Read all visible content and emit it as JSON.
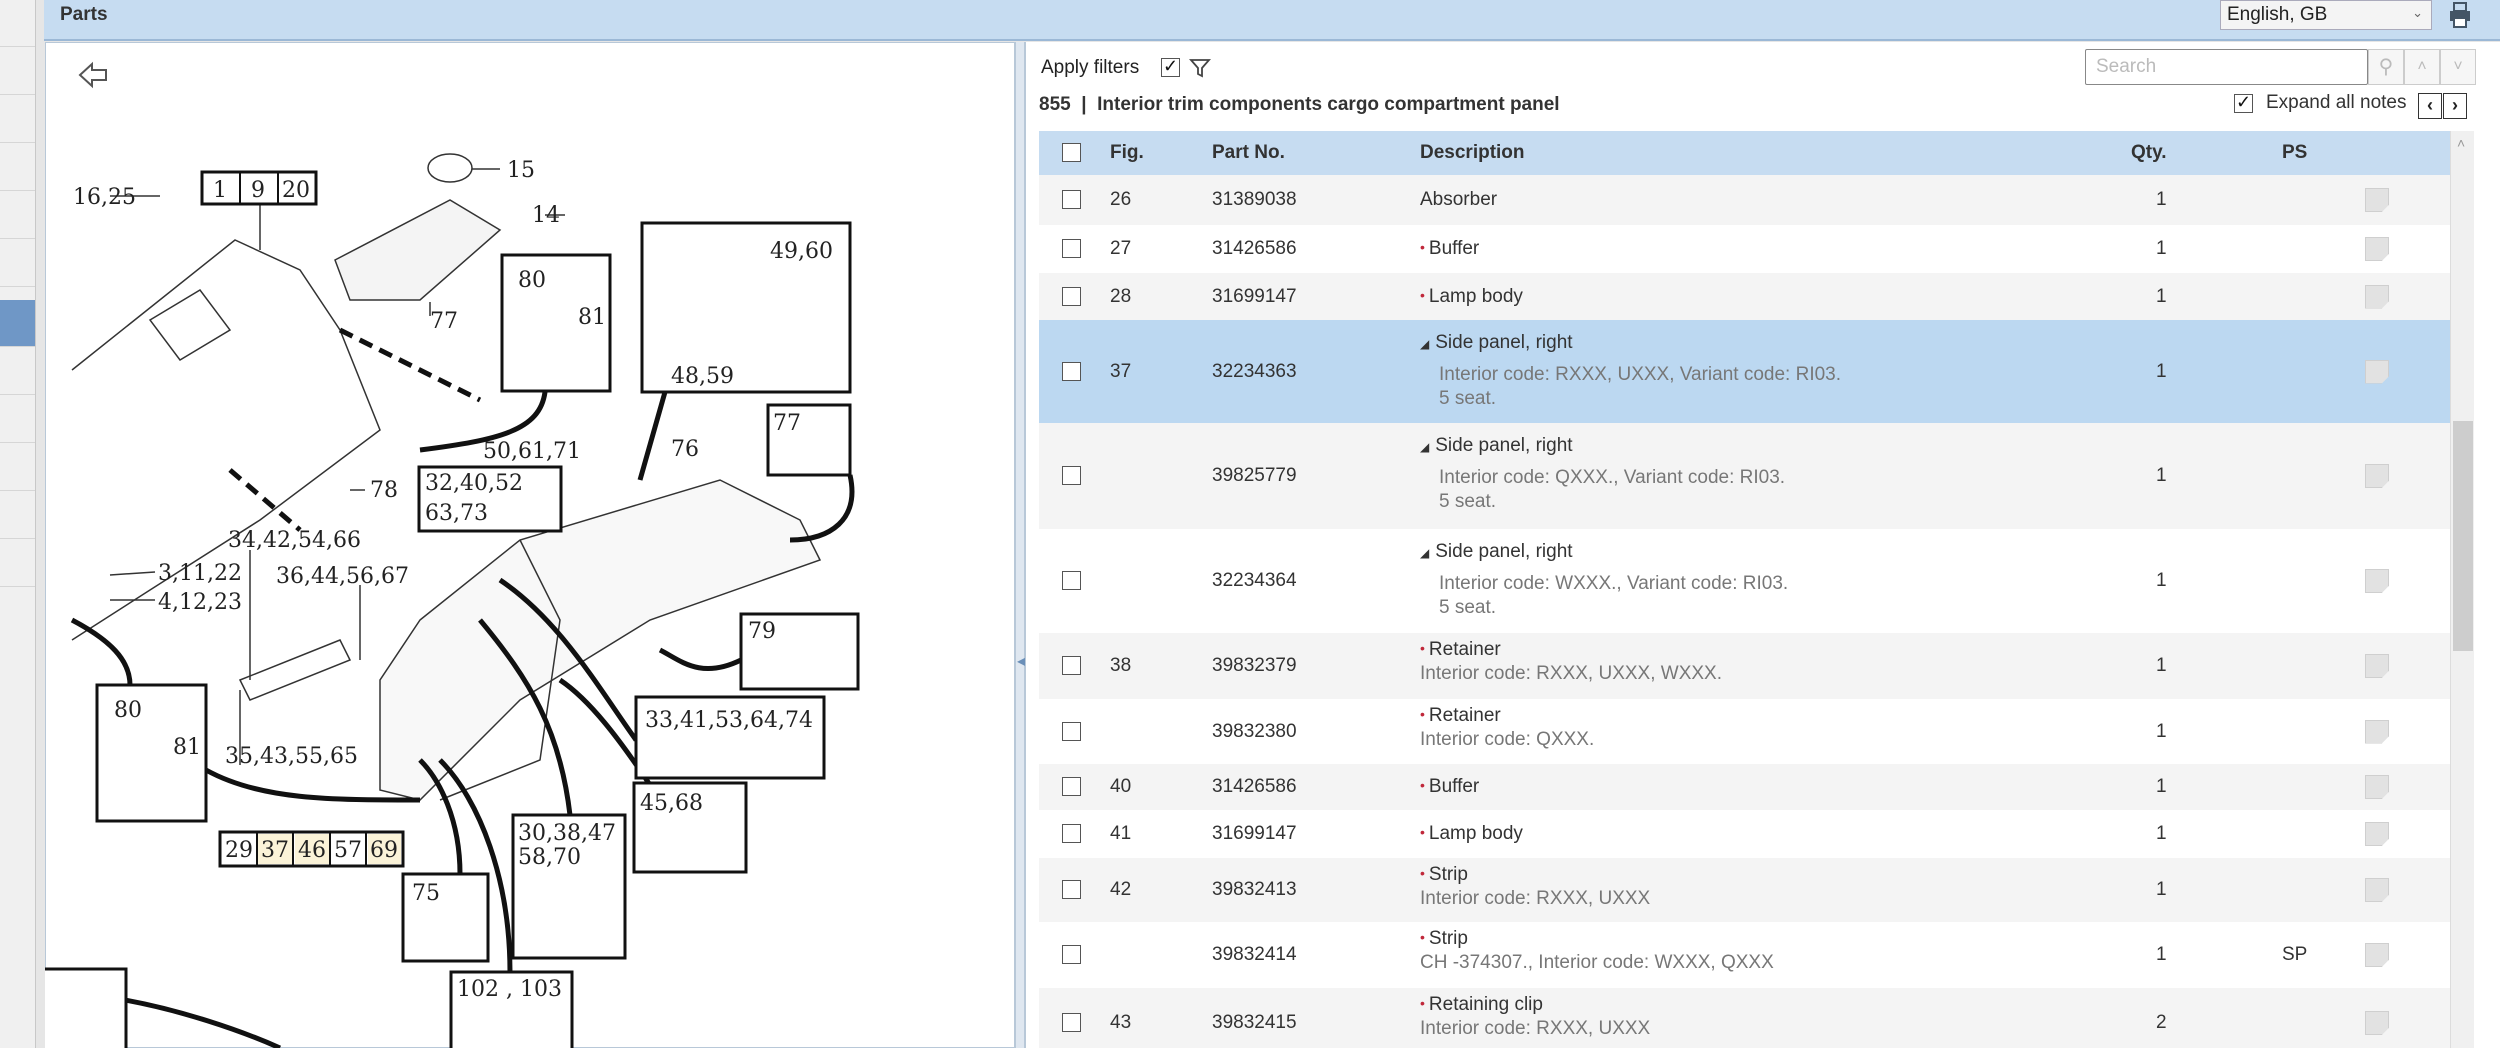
{
  "header": {
    "title": "Parts",
    "language": "English, GB"
  },
  "filters": {
    "apply_label": "Apply filters",
    "apply_checked": true,
    "search_placeholder": "Search",
    "expand_label": "Expand all notes",
    "expand_checked": true
  },
  "section": {
    "code": "855",
    "separator": "|",
    "title": "Interior trim components cargo compartment panel"
  },
  "table": {
    "columns": {
      "fig": "Fig.",
      "part": "Part No.",
      "desc": "Description",
      "qty": "Qty.",
      "ps": "PS"
    },
    "rows": [
      {
        "fig": "26",
        "part": "31389038",
        "desc": "Absorber",
        "marker": "none",
        "notes": [],
        "qty": "1",
        "ps": ""
      },
      {
        "fig": "27",
        "part": "31426586",
        "desc": "Buffer",
        "marker": "dot",
        "notes": [],
        "qty": "1",
        "ps": ""
      },
      {
        "fig": "28",
        "part": "31699147",
        "desc": "Lamp body",
        "marker": "dot",
        "notes": [],
        "qty": "1",
        "ps": ""
      },
      {
        "fig": "37",
        "part": "32234363",
        "desc": "Side panel, right",
        "marker": "triangle",
        "notes": [
          "Interior code: RXXX, UXXX, Variant code: RI03.",
          "5 seat."
        ],
        "qty": "1",
        "ps": "",
        "selected": true
      },
      {
        "fig": "",
        "part": "39825779",
        "desc": "Side panel, right",
        "marker": "triangle",
        "notes": [
          "Interior code: QXXX., Variant code: RI03.",
          "5 seat."
        ],
        "qty": "1",
        "ps": ""
      },
      {
        "fig": "",
        "part": "32234364",
        "desc": "Side panel, right",
        "marker": "triangle",
        "notes": [
          "Interior code: WXXX., Variant code: RI03.",
          "5 seat."
        ],
        "qty": "1",
        "ps": ""
      },
      {
        "fig": "38",
        "part": "39832379",
        "desc": "Retainer",
        "marker": "dot",
        "notes": [
          "Interior code: RXXX, UXXX, WXXX."
        ],
        "qty": "1",
        "ps": ""
      },
      {
        "fig": "",
        "part": "39832380",
        "desc": "Retainer",
        "marker": "dot",
        "notes": [
          "Interior code: QXXX."
        ],
        "qty": "1",
        "ps": ""
      },
      {
        "fig": "40",
        "part": "31426586",
        "desc": "Buffer",
        "marker": "dot",
        "notes": [],
        "qty": "1",
        "ps": ""
      },
      {
        "fig": "41",
        "part": "31699147",
        "desc": "Lamp body",
        "marker": "dot",
        "notes": [],
        "qty": "1",
        "ps": ""
      },
      {
        "fig": "42",
        "part": "39832413",
        "desc": "Strip",
        "marker": "dot",
        "notes": [
          "Interior code: RXXX, UXXX"
        ],
        "qty": "1",
        "ps": ""
      },
      {
        "fig": "",
        "part": "39832414",
        "desc": "Strip",
        "marker": "dot",
        "notes": [
          "CH -374307., Interior code: WXXX, QXXX"
        ],
        "qty": "1",
        "ps": "SP"
      },
      {
        "fig": "43",
        "part": "39832415",
        "desc": "Retaining clip",
        "marker": "dot",
        "notes": [
          "Interior code: RXXX, UXXX"
        ],
        "qty": "2",
        "ps": ""
      }
    ]
  },
  "diagram": {
    "labels": [
      "16,25",
      "1",
      "9",
      "20",
      "15",
      "14",
      "77",
      "80",
      "81",
      "49,60",
      "48,59",
      "77",
      "50,61,71",
      "76",
      "32,40,52",
      "63,73",
      "78",
      "34,42,54,66",
      "3,11,22",
      "4,12,23",
      "36,44,56,67",
      "79",
      "33,41,53,64,74",
      "80",
      "81",
      "35,43,55,65",
      "45,68",
      "29",
      "37",
      "46",
      "57",
      "69",
      "75",
      "30,38,47",
      "58,70",
      "102 , 103"
    ],
    "highlighted_refs": [
      "37",
      "46",
      "69"
    ]
  },
  "colors": {
    "header_bg": "#c6dcf1",
    "selected_row": "#bcd8f1",
    "bullet": "#c0283a",
    "sidebar_active": "#6f97c6"
  }
}
